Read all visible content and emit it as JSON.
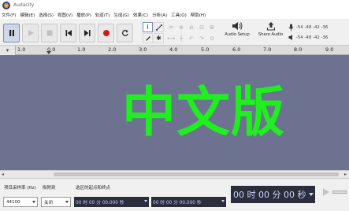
{
  "window": {
    "title": "Audacity"
  },
  "menu": {
    "items": [
      "文件(F)",
      "编辑(E)",
      "选择(S)",
      "视图(V)",
      "播放(P)",
      "轨道(T)",
      "生成(G)",
      "效果(C)",
      "分析(A)",
      "工具(O)",
      "帮助(H)"
    ]
  },
  "toolbar": {
    "audio_setup_label": "Audio Setup",
    "share_audio_label": "Share Audio",
    "meter_scale_record": "-54 -48 -42 -36",
    "meter_scale_play": "-54 -48 -42 -36"
  },
  "ruler": {
    "ticks": [
      "1.0",
      "0.0",
      "1.0",
      "2.0",
      "3.0",
      "4.0",
      "5.0",
      "6.0",
      "7.0",
      "8.0",
      "9.0"
    ]
  },
  "track_area": {
    "overlay_text": "中文版"
  },
  "selection_bar": {
    "rate_label": "项目采样率 (Hz)",
    "snap_label": "吸附到",
    "range_label": "选区的起点和终点",
    "rate_value": "44100",
    "snap_value": "关闭",
    "start_time": "00 时 00 分 00.000 秒",
    "end_time": "00 时 00 分 00.000 秒",
    "audio_position": "00 时 00 分 00 秒"
  },
  "colors": {
    "track_background": "#6d7290",
    "overlay_text": "#1ef01e",
    "time_display_bg": "#2b2d3a",
    "record_red": "#d11b1b"
  }
}
